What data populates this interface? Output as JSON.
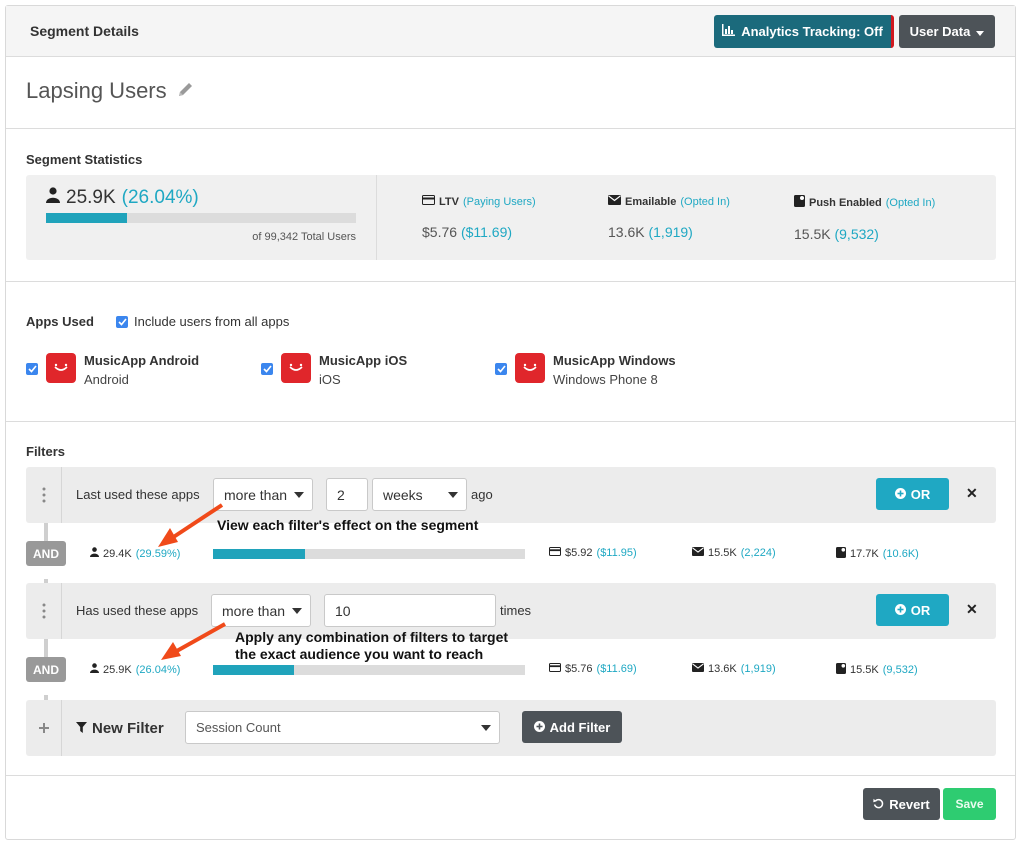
{
  "header": {
    "title": "Segment Details",
    "analytics_label": "Analytics Tracking: Off",
    "user_data_label": "User Data"
  },
  "segment": {
    "name": "Lapsing Users"
  },
  "statistics": {
    "heading": "Segment Statistics",
    "count": "25.9K",
    "percent": "(26.04%)",
    "fill_fraction": 0.2604,
    "total_text": "of 99,342 Total Users",
    "ltv": {
      "label": "LTV",
      "sub": "(Paying Users)",
      "value": "$5.76",
      "value_sub": "($11.69)"
    },
    "emailable": {
      "label": "Emailable",
      "sub": "(Opted In)",
      "value": "13.6K",
      "value_sub": "(1,919)"
    },
    "push": {
      "label": "Push Enabled",
      "sub": "(Opted In)",
      "value": "15.5K",
      "value_sub": "(9,532)"
    }
  },
  "apps": {
    "heading": "Apps Used",
    "include_all_label": "Include users from all apps",
    "include_all_checked": true,
    "items": [
      {
        "name": "MusicApp Android",
        "platform": "Android",
        "checked": true
      },
      {
        "name": "MusicApp iOS",
        "platform": "iOS",
        "checked": true
      },
      {
        "name": "MusicApp Windows",
        "platform": "Windows Phone 8",
        "checked": true
      }
    ]
  },
  "filters": {
    "heading": "Filters",
    "rows": [
      {
        "label": "Last used these apps",
        "comparator": "more than",
        "value": "2",
        "unit": "weeks",
        "suffix": "ago",
        "or_label": "OR",
        "result": {
          "logic": "AND",
          "count": "29.4K",
          "percent": "(29.59%)",
          "fill_fraction": 0.2959,
          "ltv": "$5.92",
          "ltv_sub": "($11.95)",
          "email": "15.5K",
          "email_sub": "(2,224)",
          "push": "17.7K",
          "push_sub": "(10.6K)"
        }
      },
      {
        "label": "Has used these apps",
        "comparator": "more than",
        "value": "10",
        "suffix": "times",
        "or_label": "OR",
        "result": {
          "logic": "AND",
          "count": "25.9K",
          "percent": "(26.04%)",
          "fill_fraction": 0.2604,
          "ltv": "$5.76",
          "ltv_sub": "($11.69)",
          "email": "13.6K",
          "email_sub": "(1,919)",
          "push": "15.5K",
          "push_sub": "(9,532)"
        }
      }
    ],
    "new_filter": {
      "label": "New Filter",
      "selected": "Session Count",
      "add_label": "Add Filter"
    }
  },
  "annotations": {
    "first": "View each filter's effect on the segment",
    "second_line1": "Apply any combination of filters to target",
    "second_line2": "the exact audience you want to reach"
  },
  "footer": {
    "revert_label": "Revert",
    "save_label": "Save"
  },
  "colors": {
    "teal": "#1fa8c3",
    "app_icon": "#e0262b",
    "save": "#2ecc71",
    "analytics_btn": "#1b6a7c"
  }
}
